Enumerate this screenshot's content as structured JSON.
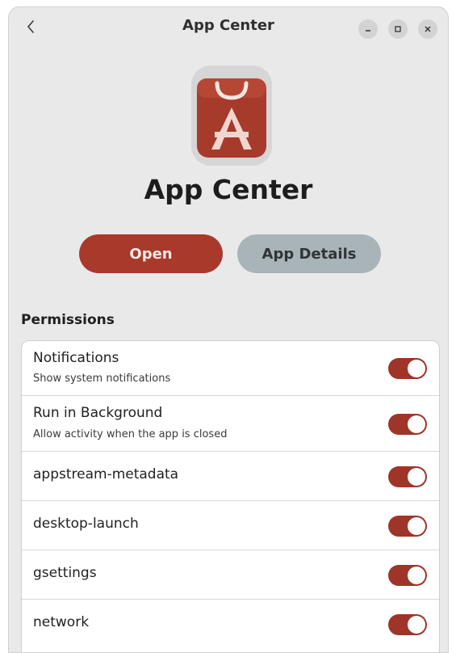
{
  "header": {
    "title": "App Center"
  },
  "app": {
    "name": "App Center"
  },
  "actions": {
    "open_label": "Open",
    "details_label": "App Details"
  },
  "permissions": {
    "section_title": "Permissions",
    "items": [
      {
        "title": "Notifications",
        "subtitle": "Show system notifications",
        "enabled": true
      },
      {
        "title": "Run in Background",
        "subtitle": "Allow activity when the app is closed",
        "enabled": true
      },
      {
        "title": "appstream-metadata",
        "enabled": true
      },
      {
        "title": "desktop-launch",
        "enabled": true
      },
      {
        "title": "gsettings",
        "enabled": true
      },
      {
        "title": "network",
        "enabled": true
      }
    ]
  },
  "colors": {
    "accent": "#a9392b",
    "toggle_on": "#9e3528",
    "secondary_button": "#a9b4b9",
    "window_bg": "#e9e9e9"
  }
}
